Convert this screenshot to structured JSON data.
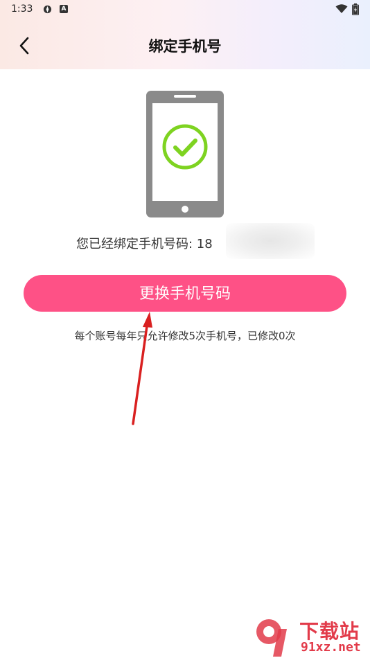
{
  "status_bar": {
    "time": "1:33",
    "icons": [
      "app-icon",
      "a-icon",
      "wifi-icon",
      "battery-icon"
    ],
    "a_label": "A"
  },
  "header": {
    "title": "绑定手机号",
    "back_icon": "chevron-left-icon"
  },
  "bound": {
    "text": "您已经绑定手机号码: 18"
  },
  "actions": {
    "change_label": "更换手机号码"
  },
  "note": {
    "text": "每个账号每年只允许修改5次手机号，已修改0次"
  },
  "watermark": {
    "title": "下载站",
    "url": "91xz.net"
  },
  "colors": {
    "accent": "#fe5186",
    "check": "#7ed321",
    "phone_gray": "#8a8a8a",
    "arrow": "#d92020"
  }
}
